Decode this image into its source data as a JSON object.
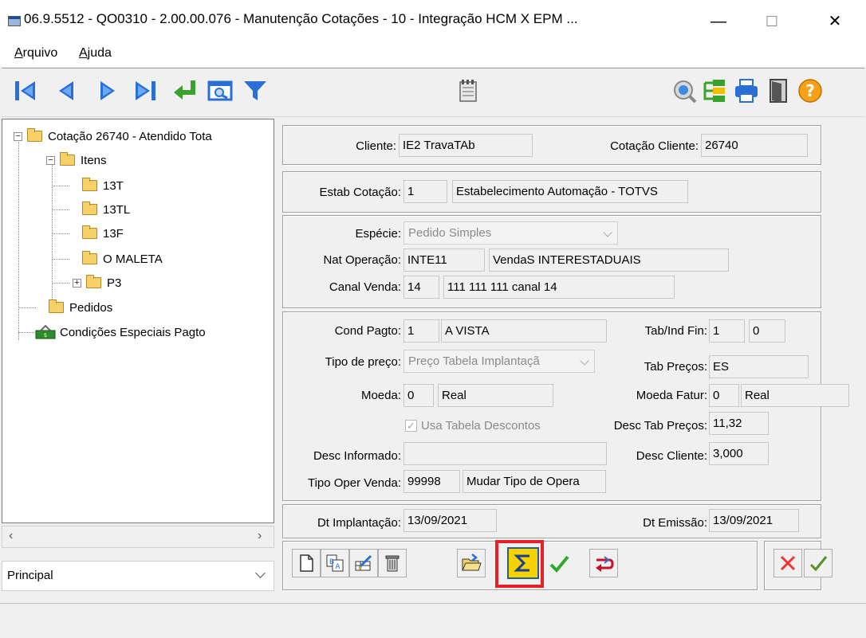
{
  "window": {
    "title": "06.9.5512 - QO0310 - 2.00.00.076 - Manutenção Cotações - 10 - Integração HCM X EPM ...",
    "minimize": "—",
    "maximize": "☐",
    "close": "✕"
  },
  "menu": {
    "arquivo_mnemonic": "A",
    "arquivo_rest": "rquivo",
    "ajuda_mnemonic": "A",
    "ajuda_rest": "juda"
  },
  "tree": {
    "root": "Cotação 26740 - Atendido Tota",
    "itens": "Itens",
    "item_13t": "13T",
    "item_13tl": "13TL",
    "item_13f": "13F",
    "item_omaleta": "O MALETA",
    "item_p3": "P3",
    "pedidos": "Pedidos",
    "condicoes": "Condições Especiais Pagto"
  },
  "principal": {
    "value": "Principal"
  },
  "header": {
    "cliente_label": "Cliente:",
    "cliente_value": "IE2 TravaTAb",
    "cotacao_cliente_label": "Cotação Cliente:",
    "cotacao_cliente_value": "26740"
  },
  "estab": {
    "label": "Estab Cotação:",
    "code": "1",
    "name": "Estabelecimento Automação - TOTVS"
  },
  "natureza": {
    "especie_label": "Espécie:",
    "especie_value": "Pedido Simples",
    "nat_label": "Nat Operação:",
    "nat_code": "INTE11",
    "nat_desc": "VendaS INTERESTADUAIS",
    "canal_label": "Canal Venda:",
    "canal_code": "14",
    "canal_desc": "111 111 111 canal 14"
  },
  "pagto": {
    "cond_label": "Cond Pagto:",
    "cond_code": "1",
    "cond_desc": "A VISTA",
    "tabind_label": "Tab/Ind Fin:",
    "tabind_1": "1",
    "tabind_2": "0",
    "tipo_preco_label": "Tipo de preço:",
    "tipo_preco_value": "Preço Tabela Implantaçã",
    "tab_precos_label": "Tab Preços:",
    "tab_precos_value": "ES",
    "moeda_label": "Moeda:",
    "moeda_code": "0",
    "moeda_desc": "Real",
    "moeda_fatur_label": "Moeda Fatur:",
    "moeda_fatur_code": "0",
    "moeda_fatur_desc": "Real",
    "usa_tabela_label": "Usa Tabela Descontos",
    "desc_tab_label": "Desc Tab Preços:",
    "desc_tab_value": "11,32",
    "desc_inf_label": "Desc Informado:",
    "desc_inf_value": "",
    "desc_cli_label": "Desc Cliente:",
    "desc_cli_value": "3,000",
    "tipo_oper_label": "Tipo Oper Venda:",
    "tipo_oper_code": "99998",
    "tipo_oper_desc": "Mudar Tipo de Opera"
  },
  "datas": {
    "implant_label": "Dt Implantação:",
    "implant_value": "13/09/2021",
    "emissao_label": "Dt Emissão:",
    "emissao_value": "13/09/2021"
  },
  "highlight_color": "#e8202a"
}
